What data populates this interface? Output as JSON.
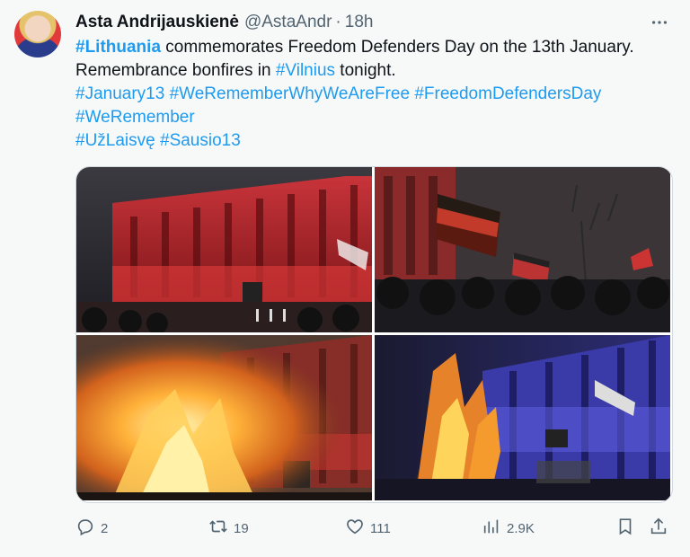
{
  "author": {
    "name": "Asta Andrijauskienė",
    "handle": "@AstaAndr",
    "separator": "·",
    "time": "18h"
  },
  "tweet": {
    "line1_link": "#Lithuania",
    "line1_text": " commemorates Freedom Defenders Day on the 13th January.",
    "line2_text": "Remembrance bonfires in ",
    "line2_link": "#Vilnius",
    "line2_end": " tonight.",
    "hashtags_row1": [
      "#January13",
      "#WeRememberWhyWeAreFree",
      "#FreedomDefendersDay"
    ],
    "hashtags_row2": [
      "#WeRemember"
    ],
    "hashtags_row3": [
      "#UžLaisvę",
      "#Sausio13"
    ]
  },
  "actions": {
    "replies": "2",
    "reposts": "19",
    "likes": "111",
    "views": "2.9K"
  },
  "colors": {
    "link": "#1d9bf0",
    "muted": "#536471",
    "text": "#0f1419"
  },
  "icons": [
    "reply-icon",
    "repost-icon",
    "like-icon",
    "views-icon",
    "bookmark-icon",
    "share-icon",
    "more-icon"
  ]
}
